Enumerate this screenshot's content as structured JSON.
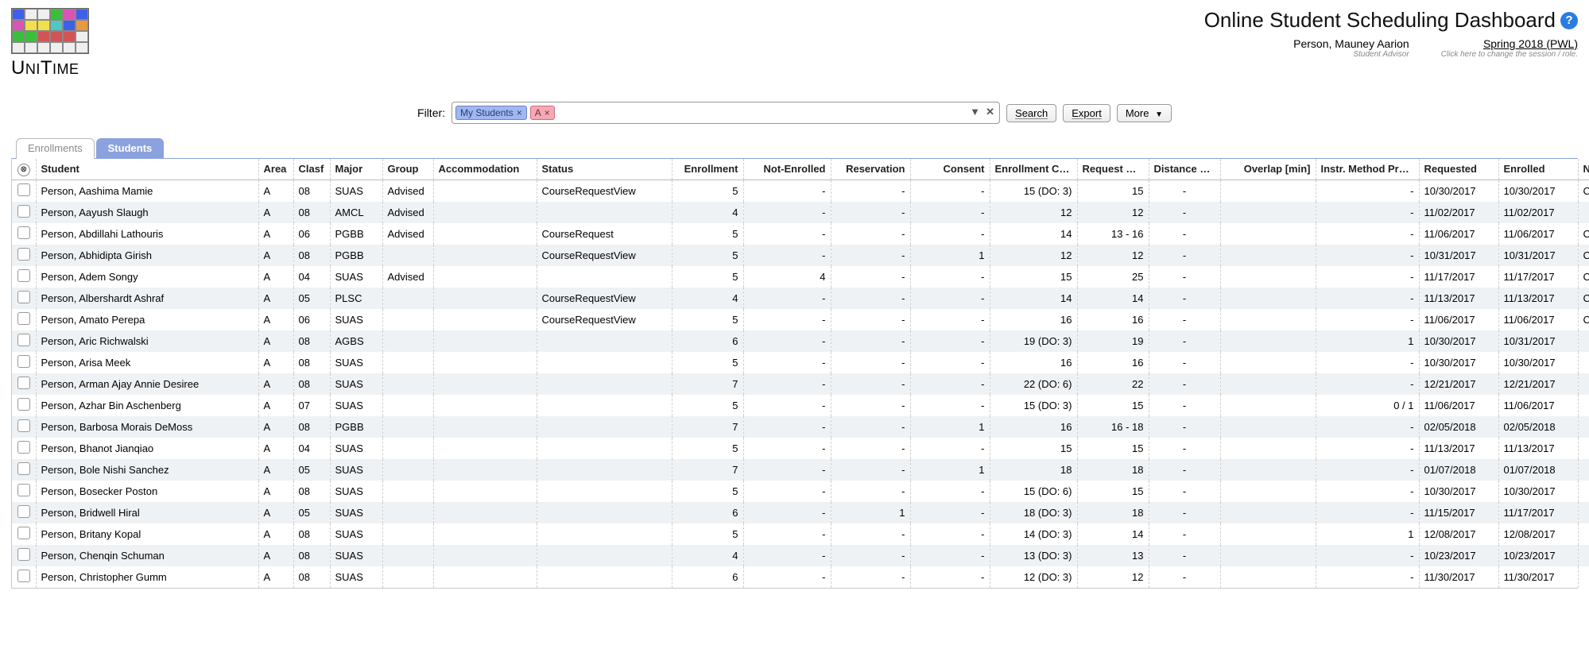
{
  "header": {
    "pageTitle": "Online Student Scheduling Dashboard",
    "userName": "Person, Mauney Aarion",
    "userRole": "Student Advisor",
    "sessionName": "Spring 2018 (PWL)",
    "sessionHint": "Click here to change the session / role."
  },
  "filter": {
    "label": "Filter:",
    "chips": [
      {
        "text": "My Students",
        "color": "blue"
      },
      {
        "text": "A",
        "color": "pink"
      }
    ],
    "buttons": {
      "search": "Search",
      "export": "Export",
      "more": "More"
    }
  },
  "tabs": {
    "enrollments": "Enrollments",
    "students": "Students"
  },
  "columns": {
    "student": "Student",
    "area": "Area",
    "clasf": "Clasf",
    "major": "Major",
    "group": "Group",
    "accommodation": "Accommodation",
    "status": "Status",
    "enrollment": "Enrollment",
    "notEnrolled": "Not-Enrolled",
    "reservation": "Reservation",
    "consent": "Consent",
    "enrollmentCredit": "Enrollment Credit",
    "requestCredit": "Request Credit",
    "distanceConflicts": "Distance Conflicts",
    "overlap": "Overlap [min]",
    "instrMethod": "Instr. Method Preferences",
    "requested": "Requested",
    "enrolled": "Enrolled",
    "note": "Note"
  },
  "rows": [
    {
      "student": "Person, Aashima Mamie",
      "area": "A",
      "clasf": "08",
      "major": "SUAS",
      "group": "Advised",
      "accom": "",
      "status": "CourseRequestView",
      "enrollment": "5",
      "notEnrolled": "-",
      "reservation": "-",
      "consent": "-",
      "ecred": "15 (DO: 3)",
      "rcred": "15",
      "dist": "-",
      "overlap": "",
      "instr": "-",
      "requested": "10/30/2017",
      "enrolled": "10/30/2017",
      "note": "Changed"
    },
    {
      "student": "Person, Aayush Slaugh",
      "area": "A",
      "clasf": "08",
      "major": "AMCL",
      "group": "Advised",
      "accom": "",
      "status": "",
      "enrollment": "4",
      "notEnrolled": "-",
      "reservation": "-",
      "consent": "-",
      "ecred": "12",
      "rcred": "12",
      "dist": "-",
      "overlap": "",
      "instr": "-",
      "requested": "11/02/2017",
      "enrolled": "11/02/2017",
      "note": ""
    },
    {
      "student": "Person, Abdillahi Lathouris",
      "area": "A",
      "clasf": "06",
      "major": "PGBB",
      "group": "Advised",
      "accom": "",
      "status": "CourseRequest",
      "enrollment": "5",
      "notEnrolled": "-",
      "reservation": "-",
      "consent": "-",
      "ecred": "14",
      "rcred": "13 - 16",
      "dist": "-",
      "overlap": "",
      "instr": "-",
      "requested": "11/06/2017",
      "enrolled": "11/06/2017",
      "note": "Changed"
    },
    {
      "student": "Person, Abhidipta Girish",
      "area": "A",
      "clasf": "08",
      "major": "PGBB",
      "group": "",
      "accom": "",
      "status": "CourseRequestView",
      "enrollment": "5",
      "notEnrolled": "-",
      "reservation": "-",
      "consent": "1",
      "ecred": "12",
      "rcred": "12",
      "dist": "-",
      "overlap": "",
      "instr": "-",
      "requested": "10/31/2017",
      "enrolled": "10/31/2017",
      "note": "Changed"
    },
    {
      "student": "Person, Adem Songy",
      "area": "A",
      "clasf": "04",
      "major": "SUAS",
      "group": "Advised",
      "accom": "",
      "status": "",
      "enrollment": "5",
      "notEnrolled": "4",
      "reservation": "-",
      "consent": "-",
      "ecred": "15",
      "rcred": "25",
      "dist": "-",
      "overlap": "",
      "instr": "-",
      "requested": "11/17/2017",
      "enrolled": "11/17/2017",
      "note": "Changed again"
    },
    {
      "student": "Person, Albershardt Ashraf",
      "area": "A",
      "clasf": "05",
      "major": "PLSC",
      "group": "",
      "accom": "",
      "status": "CourseRequestView",
      "enrollment": "4",
      "notEnrolled": "-",
      "reservation": "-",
      "consent": "-",
      "ecred": "14",
      "rcred": "14",
      "dist": "-",
      "overlap": "",
      "instr": "-",
      "requested": "11/13/2017",
      "enrolled": "11/13/2017",
      "note": "Changed yet again"
    },
    {
      "student": "Person, Amato Perepa",
      "area": "A",
      "clasf": "06",
      "major": "SUAS",
      "group": "",
      "accom": "",
      "status": "CourseRequestView",
      "enrollment": "5",
      "notEnrolled": "-",
      "reservation": "-",
      "consent": "-",
      "ecred": "16",
      "rcred": "16",
      "dist": "-",
      "overlap": "",
      "instr": "-",
      "requested": "11/06/2017",
      "enrolled": "11/06/2017",
      "note": "Changed yet again"
    },
    {
      "student": "Person, Aric Richwalski",
      "area": "A",
      "clasf": "08",
      "major": "AGBS",
      "group": "",
      "accom": "",
      "status": "",
      "enrollment": "6",
      "notEnrolled": "-",
      "reservation": "-",
      "consent": "-",
      "ecred": "19 (DO: 3)",
      "rcred": "19",
      "dist": "-",
      "overlap": "",
      "instr": "1",
      "requested": "10/30/2017",
      "enrolled": "10/31/2017",
      "note": ""
    },
    {
      "student": "Person, Arisa Meek",
      "area": "A",
      "clasf": "08",
      "major": "SUAS",
      "group": "",
      "accom": "",
      "status": "",
      "enrollment": "5",
      "notEnrolled": "-",
      "reservation": "-",
      "consent": "-",
      "ecred": "16",
      "rcred": "16",
      "dist": "-",
      "overlap": "",
      "instr": "-",
      "requested": "10/30/2017",
      "enrolled": "10/30/2017",
      "note": ""
    },
    {
      "student": "Person, Arman Ajay Annie Desiree",
      "area": "A",
      "clasf": "08",
      "major": "SUAS",
      "group": "",
      "accom": "",
      "status": "",
      "enrollment": "7",
      "notEnrolled": "-",
      "reservation": "-",
      "consent": "-",
      "ecred": "22 (DO: 6)",
      "rcred": "22",
      "dist": "-",
      "overlap": "",
      "instr": "-",
      "requested": "12/21/2017",
      "enrolled": "12/21/2017",
      "note": ""
    },
    {
      "student": "Person, Azhar Bin Aschenberg",
      "area": "A",
      "clasf": "07",
      "major": "SUAS",
      "group": "",
      "accom": "",
      "status": "",
      "enrollment": "5",
      "notEnrolled": "-",
      "reservation": "-",
      "consent": "-",
      "ecred": "15 (DO: 3)",
      "rcred": "15",
      "dist": "-",
      "overlap": "",
      "instr": "0 / 1",
      "requested": "11/06/2017",
      "enrolled": "11/06/2017",
      "note": ""
    },
    {
      "student": "Person, Barbosa Morais DeMoss",
      "area": "A",
      "clasf": "08",
      "major": "PGBB",
      "group": "",
      "accom": "",
      "status": "",
      "enrollment": "7",
      "notEnrolled": "-",
      "reservation": "-",
      "consent": "1",
      "ecred": "16",
      "rcred": "16 - 18",
      "dist": "-",
      "overlap": "",
      "instr": "-",
      "requested": "02/05/2018",
      "enrolled": "02/05/2018",
      "note": ""
    },
    {
      "student": "Person, Bhanot Jianqiao",
      "area": "A",
      "clasf": "04",
      "major": "SUAS",
      "group": "",
      "accom": "",
      "status": "",
      "enrollment": "5",
      "notEnrolled": "-",
      "reservation": "-",
      "consent": "-",
      "ecred": "15",
      "rcred": "15",
      "dist": "-",
      "overlap": "",
      "instr": "-",
      "requested": "11/13/2017",
      "enrolled": "11/13/2017",
      "note": ""
    },
    {
      "student": "Person, Bole Nishi Sanchez",
      "area": "A",
      "clasf": "05",
      "major": "SUAS",
      "group": "",
      "accom": "",
      "status": "",
      "enrollment": "7",
      "notEnrolled": "-",
      "reservation": "-",
      "consent": "1",
      "ecred": "18",
      "rcred": "18",
      "dist": "-",
      "overlap": "",
      "instr": "-",
      "requested": "01/07/2018",
      "enrolled": "01/07/2018",
      "note": ""
    },
    {
      "student": "Person, Bosecker Poston",
      "area": "A",
      "clasf": "08",
      "major": "SUAS",
      "group": "",
      "accom": "",
      "status": "",
      "enrollment": "5",
      "notEnrolled": "-",
      "reservation": "-",
      "consent": "-",
      "ecred": "15 (DO: 6)",
      "rcred": "15",
      "dist": "-",
      "overlap": "",
      "instr": "-",
      "requested": "10/30/2017",
      "enrolled": "10/30/2017",
      "note": ""
    },
    {
      "student": "Person, Bridwell Hiral",
      "area": "A",
      "clasf": "05",
      "major": "SUAS",
      "group": "",
      "accom": "",
      "status": "",
      "enrollment": "6",
      "notEnrolled": "-",
      "reservation": "1",
      "consent": "-",
      "ecred": "18 (DO: 3)",
      "rcred": "18",
      "dist": "-",
      "overlap": "",
      "instr": "-",
      "requested": "11/15/2017",
      "enrolled": "11/17/2017",
      "note": ""
    },
    {
      "student": "Person, Britany Kopal",
      "area": "A",
      "clasf": "08",
      "major": "SUAS",
      "group": "",
      "accom": "",
      "status": "",
      "enrollment": "5",
      "notEnrolled": "-",
      "reservation": "-",
      "consent": "-",
      "ecred": "14 (DO: 3)",
      "rcred": "14",
      "dist": "-",
      "overlap": "",
      "instr": "1",
      "requested": "12/08/2017",
      "enrolled": "12/08/2017",
      "note": ""
    },
    {
      "student": "Person, Chenqin Schuman",
      "area": "A",
      "clasf": "08",
      "major": "SUAS",
      "group": "",
      "accom": "",
      "status": "",
      "enrollment": "4",
      "notEnrolled": "-",
      "reservation": "-",
      "consent": "-",
      "ecred": "13 (DO: 3)",
      "rcred": "13",
      "dist": "-",
      "overlap": "",
      "instr": "-",
      "requested": "10/23/2017",
      "enrolled": "10/23/2017",
      "note": ""
    },
    {
      "student": "Person, Christopher Gumm",
      "area": "A",
      "clasf": "08",
      "major": "SUAS",
      "group": "",
      "accom": "",
      "status": "",
      "enrollment": "6",
      "notEnrolled": "-",
      "reservation": "-",
      "consent": "-",
      "ecred": "12 (DO: 3)",
      "rcred": "12",
      "dist": "-",
      "overlap": "",
      "instr": "-",
      "requested": "11/30/2017",
      "enrolled": "11/30/2017",
      "note": ""
    }
  ]
}
